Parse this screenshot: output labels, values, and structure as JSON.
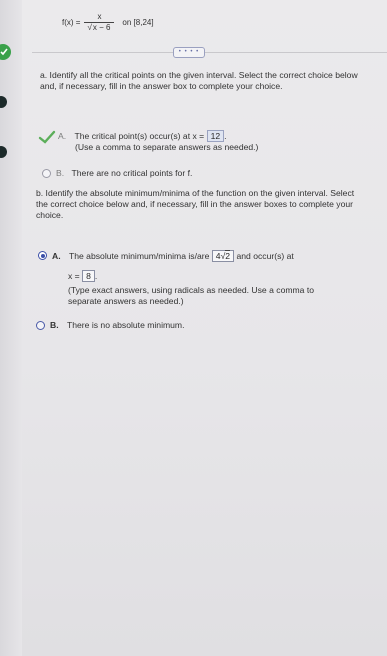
{
  "function": {
    "lhs": "f(x) =",
    "numerator": "x",
    "denominator": "x − 6",
    "interval": "on [8,24]"
  },
  "more_button": {
    "label": "• • • •"
  },
  "part_a": {
    "prompt": "a. Identify all the critical points on the given interval. Select the correct choice below and, if necessary, fill in the answer box to complete your choice.",
    "option_a_letter": "A.",
    "option_a_text": "The critical point(s) occur(s) at x =",
    "option_a_value": "12",
    "option_a_hint": "(Use a comma to separate answers as needed.)",
    "option_b_letter": "B.",
    "option_b_text": "There are no critical points for f."
  },
  "part_b": {
    "prompt": "b. Identify the absolute minimum/minima of the function on the given interval. Select the correct choice below and, if necessary, fill in the answer boxes to complete your choice.",
    "option_a_letter": "A.",
    "option_a_text_1": "The absolute minimum/minima is/are",
    "option_a_value_coef": "4",
    "option_a_value_rad": "2",
    "option_a_text_2": "and occur(s) at",
    "option_a_x_label": "x =",
    "option_a_x_value": "8",
    "option_a_hint": "(Type exact answers, using radicals as needed. Use a comma to separate answers as needed.)",
    "option_b_letter": "B.",
    "option_b_text": "There is no absolute minimum."
  },
  "colors": {
    "selected_radio": "#3b4fa8",
    "correct_check": "#5cae5a",
    "sidebar_done": "#3aa14a"
  }
}
